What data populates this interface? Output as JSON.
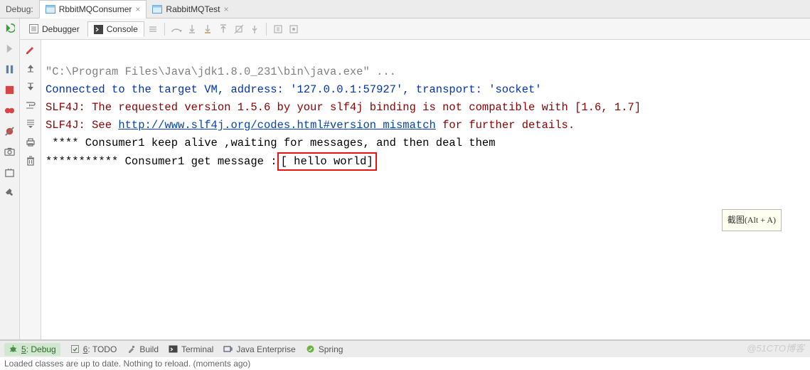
{
  "topTabs": {
    "label": "Debug:",
    "items": [
      {
        "name": "RbbitMQConsumer",
        "active": true
      },
      {
        "name": "RabbitMQTest",
        "active": false
      }
    ]
  },
  "subTabs": {
    "debugger": "Debugger",
    "console": "Console"
  },
  "consoleLines": {
    "l1": "\"C:\\Program Files\\Java\\jdk1.8.0_231\\bin\\java.exe\" ...",
    "l2": "Connected to the target VM, address: '127.0.0.1:57927', transport: 'socket'",
    "l3": "SLF4J: The requested version 1.5.6 by your slf4j binding is not compatible with [1.6, 1.7]",
    "l4a": "SLF4J: See ",
    "l4link": "http://www.slf4j.org/codes.html#version_mismatch",
    "l4b": " for further details.",
    "l5": " **** Consumer1 keep alive ,waiting for messages, and then deal them",
    "l6a": "*********** Consumer1 get message :",
    "l6box": "[ hello world]"
  },
  "tooltip": "截图(Alt + A)",
  "bottomTabs": {
    "debug": {
      "key": "5",
      "label": ": Debug"
    },
    "todo": {
      "key": "6",
      "label": ": TODO"
    },
    "build": "Build",
    "terminal": "Terminal",
    "java": "Java Enterprise",
    "spring": "Spring"
  },
  "status": "Loaded classes are up to date. Nothing to reload. (moments ago)",
  "watermark": "@51CTO博客"
}
